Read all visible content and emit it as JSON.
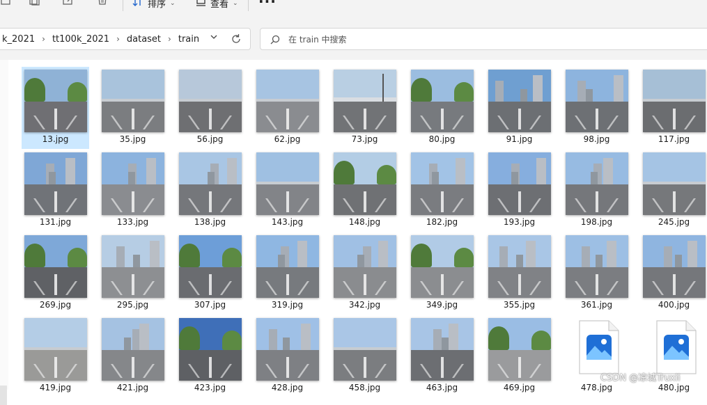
{
  "toolbar": {
    "sort_label": "排序",
    "view_label": "查看",
    "more_label": "···"
  },
  "address": {
    "crumbs": [
      "k_2021",
      "tt100k_2021",
      "dataset",
      "train"
    ]
  },
  "search": {
    "placeholder": "在 train 中搜索"
  },
  "files": [
    {
      "name": "13.jpg",
      "sky": "#8fb2d6",
      "road": "#6f6f73",
      "scene": "trees",
      "selected": true
    },
    {
      "name": "35.jpg",
      "sky": "#a9c3dc",
      "road": "#7b7d80",
      "scene": "plain"
    },
    {
      "name": "56.jpg",
      "sky": "#b7c8da",
      "road": "#6e6f72",
      "scene": "plain"
    },
    {
      "name": "62.jpg",
      "sky": "#a7c4e2",
      "road": "#8a8c90",
      "scene": "plain"
    },
    {
      "name": "73.jpg",
      "sky": "#b9cfe3",
      "road": "#717376",
      "scene": "bridge"
    },
    {
      "name": "80.jpg",
      "sky": "#9bbde0",
      "road": "#777a7e",
      "scene": "trees"
    },
    {
      "name": "91.jpg",
      "sky": "#6f9fd1",
      "road": "#6c6f73",
      "scene": "city"
    },
    {
      "name": "98.jpg",
      "sky": "#8db4de",
      "road": "#6d7074",
      "scene": "city"
    },
    {
      "name": "117.jpg",
      "sky": "#a6bfd6",
      "road": "#6b6d70",
      "scene": "plain"
    },
    {
      "name": "131.jpg",
      "sky": "#7fa7d6",
      "road": "#707378",
      "scene": "city"
    },
    {
      "name": "133.jpg",
      "sky": "#8cb3de",
      "road": "#8a8c90",
      "scene": "city"
    },
    {
      "name": "138.jpg",
      "sky": "#a9c6e4",
      "road": "#75777b",
      "scene": "city"
    },
    {
      "name": "143.jpg",
      "sky": "#9fc0e2",
      "road": "#828488",
      "scene": "plain"
    },
    {
      "name": "148.jpg",
      "sky": "#b3cde5",
      "road": "#6f7174",
      "scene": "trees"
    },
    {
      "name": "182.jpg",
      "sky": "#a2c3e6",
      "road": "#7a7c80",
      "scene": "city"
    },
    {
      "name": "193.jpg",
      "sky": "#86aede",
      "road": "#6d6f73",
      "scene": "city"
    },
    {
      "name": "198.jpg",
      "sky": "#97bbe2",
      "road": "#75777b",
      "scene": "city"
    },
    {
      "name": "245.jpg",
      "sky": "#a5c4e4",
      "road": "#76787b",
      "scene": "plain"
    },
    {
      "name": "269.jpg",
      "sky": "#7ea8d8",
      "road": "#5f6165",
      "scene": "trees"
    },
    {
      "name": "295.jpg",
      "sky": "#b6cde4",
      "road": "#8d8f92",
      "scene": "city"
    },
    {
      "name": "307.jpg",
      "sky": "#6d9ed8",
      "road": "#6a6c70",
      "scene": "trees"
    },
    {
      "name": "319.jpg",
      "sky": "#8fb7e2",
      "road": "#777a7e",
      "scene": "city"
    },
    {
      "name": "342.jpg",
      "sky": "#a0c0e4",
      "road": "#8a8c8f",
      "scene": "city"
    },
    {
      "name": "349.jpg",
      "sky": "#b1cbe6",
      "road": "#8b8d90",
      "scene": "trees"
    },
    {
      "name": "355.jpg",
      "sky": "#a9c6e6",
      "road": "#808286",
      "scene": "city"
    },
    {
      "name": "361.jpg",
      "sky": "#9dbfe4",
      "road": "#7b7d81",
      "scene": "city"
    },
    {
      "name": "400.jpg",
      "sky": "#8fb5e0",
      "road": "#75777b",
      "scene": "city"
    },
    {
      "name": "419.jpg",
      "sky": "#b4cde6",
      "road": "#9a9a98",
      "scene": "plain"
    },
    {
      "name": "421.jpg",
      "sky": "#a5c2e2",
      "road": "#85878a",
      "scene": "city"
    },
    {
      "name": "423.jpg",
      "sky": "#3f6fb8",
      "road": "#5e6064",
      "scene": "trees"
    },
    {
      "name": "428.jpg",
      "sky": "#9fc0e6",
      "road": "#7e8084",
      "scene": "city"
    },
    {
      "name": "458.jpg",
      "sky": "#aac6e6",
      "road": "#7b7d80",
      "scene": "plain"
    },
    {
      "name": "463.jpg",
      "sky": "#a8c5e6",
      "road": "#6c6e72",
      "scene": "city"
    },
    {
      "name": "469.jpg",
      "sky": "#9abde4",
      "road": "#9a9b9d",
      "scene": "trees"
    },
    {
      "name": "478.jpg",
      "generic": true
    },
    {
      "name": "480.jpg",
      "generic": true
    }
  ],
  "watermark": "CSDN @凉城Truxii",
  "colors": {
    "toolbar_bg": "#f3f3f3",
    "selection": "#cce8ff",
    "photo_icon_blue": "#1f6fd6"
  }
}
